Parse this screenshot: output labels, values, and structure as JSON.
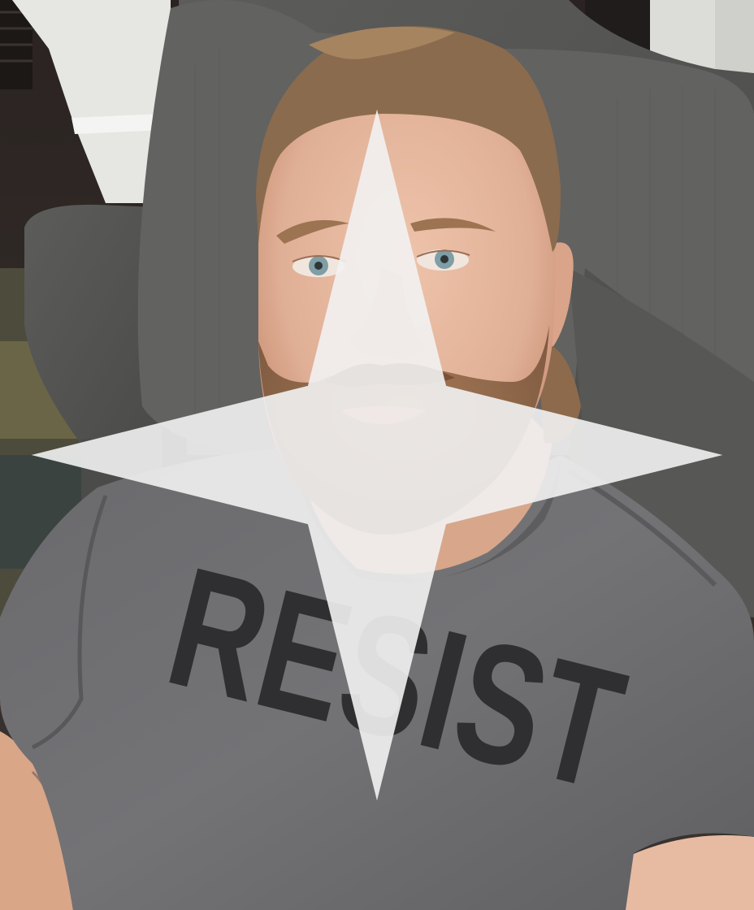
{
  "photo": {
    "shirt_text": "RESIST",
    "colors": {
      "background_dark": "#2b2523",
      "wall": "#e8e8e4",
      "couch": "#5a5a58",
      "couch_shadow": "#3e3e3d",
      "pillow": "#646462",
      "shirt": "#6e6e70",
      "shirt_shadow": "#58585a",
      "skin": "#e3b69e",
      "skin_shadow": "#c9957c",
      "hair": "#8c6a4c",
      "beard": "#9a7052",
      "eye": "#7f9ea6",
      "print": "#2a2a2c"
    }
  },
  "watermark": {
    "icon": "sparkle-icon"
  }
}
